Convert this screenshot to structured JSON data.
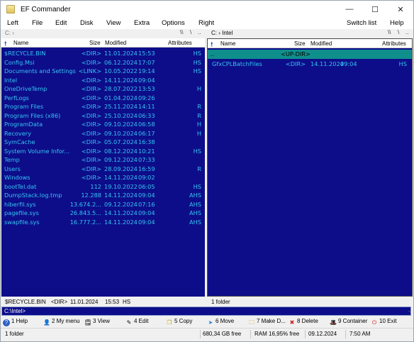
{
  "window": {
    "title": "EF Commander",
    "controls": {
      "minimize": "—",
      "maximize": "☐",
      "close": "✕"
    }
  },
  "menu": {
    "items": [
      "Left",
      "File",
      "Edit",
      "Disk",
      "View",
      "Extra",
      "Options",
      "Right"
    ],
    "switch_list": "Switch list",
    "help": "Help"
  },
  "left_panel": {
    "path": "C: ›",
    "path_controls": [
      "\\\\",
      "\\",
      ".."
    ],
    "headers": {
      "name": "Name",
      "size": "Size",
      "modified": "Modified",
      "attributes": "Attributes"
    },
    "rows": [
      {
        "name": "$RECYCLE.BIN",
        "size": "<DIR>",
        "date": "11.01.2024",
        "time": "15:53",
        "attr": "HS"
      },
      {
        "name": "Config.Msi",
        "size": "<DIR>",
        "date": "06.12.2024",
        "time": "17:07",
        "attr": "HS"
      },
      {
        "name": "Documents and Settings",
        "size": "<LINK>",
        "date": "10.05.2022",
        "time": "19:14",
        "attr": "HS"
      },
      {
        "name": "Intel",
        "size": "<DIR>",
        "date": "14.11.2024",
        "time": "09:04",
        "attr": ""
      },
      {
        "name": "OneDriveTemp",
        "size": "<DIR>",
        "date": "28.07.2022",
        "time": "13:53",
        "attr": "H"
      },
      {
        "name": "PerfLogs",
        "size": "<DIR>",
        "date": "01.04.2024",
        "time": "09:26",
        "attr": ""
      },
      {
        "name": "Program Files",
        "size": "<DIR>",
        "date": "25.11.2024",
        "time": "14:11",
        "attr": "R"
      },
      {
        "name": "Program Files (x86)",
        "size": "<DIR>",
        "date": "25.10.2024",
        "time": "06:33",
        "attr": "R"
      },
      {
        "name": "ProgramData",
        "size": "<DIR>",
        "date": "09.10.2024",
        "time": "06:58",
        "attr": "H"
      },
      {
        "name": "Recovery",
        "size": "<DIR>",
        "date": "09.10.2024",
        "time": "06:17",
        "attr": "H"
      },
      {
        "name": "SymCache",
        "size": "<DIR>",
        "date": "05.07.2024",
        "time": "16:38",
        "attr": ""
      },
      {
        "name": "System Volume Infor...",
        "size": "<DIR>",
        "date": "08.12.2024",
        "time": "10:21",
        "attr": "HS"
      },
      {
        "name": "Temp",
        "size": "<DIR>",
        "date": "09.12.2024",
        "time": "07:33",
        "attr": ""
      },
      {
        "name": "Users",
        "size": "<DIR>",
        "date": "28.09.2024",
        "time": "16:59",
        "attr": "R"
      },
      {
        "name": "Windows",
        "size": "<DIR>",
        "date": "14.11.2024",
        "time": "09:02",
        "attr": ""
      },
      {
        "name": "bootTel.dat",
        "size": "112",
        "date": "19.10.2022",
        "time": "06:05",
        "attr": "HS"
      },
      {
        "name": "DumpStack.log.tmp",
        "size": "12.288",
        "date": "14.11.2024",
        "time": "09:04",
        "attr": "AHS"
      },
      {
        "name": "hiberfil.sys",
        "size": "13.674.2...",
        "date": "09.12.2024",
        "time": "07:16",
        "attr": "AHS"
      },
      {
        "name": "pagefile.sys",
        "size": "26.843.5...",
        "date": "14.11.2024",
        "time": "09:04",
        "attr": "AHS"
      },
      {
        "name": "swapfile.sys",
        "size": "16.777.2...",
        "date": "14.11.2024",
        "time": "09:04",
        "attr": "AHS"
      }
    ],
    "info": {
      "name": "$RECYCLE.BIN",
      "size": "<DIR>",
      "date": "11.01.2024",
      "time": "15:53",
      "attr": "HS"
    }
  },
  "right_panel": {
    "path": "C: › Intel",
    "path_controls": [
      "\\\\",
      "\\",
      ".."
    ],
    "headers": {
      "name": "Name",
      "size": "Size",
      "modified": "Modified",
      "attributes": "Attributes"
    },
    "updir": {
      "name": "..",
      "label": "<UP-DIR>"
    },
    "rows": [
      {
        "name": "GfxCPLBatchFiles",
        "size": "<DIR>",
        "date": "14.11.2024",
        "time": "09:04",
        "attr": "HS"
      }
    ],
    "info": "1 folder"
  },
  "command_line": {
    "value": "C:\\Intel>"
  },
  "function_keys": [
    {
      "label": "1 Help",
      "icon": "help-icon"
    },
    {
      "label": "2 My menu",
      "icon": "user-icon"
    },
    {
      "label": "3 View",
      "icon": "view-icon"
    },
    {
      "label": "4 Edit",
      "icon": "edit-icon"
    },
    {
      "label": "5 Copy",
      "icon": "copy-icon"
    },
    {
      "label": "6 Move",
      "icon": "move-icon"
    },
    {
      "label": "7 Make D...",
      "icon": "make-dir-icon"
    },
    {
      "label": "8 Delete",
      "icon": "delete-icon"
    },
    {
      "label": "9 Container",
      "icon": "container-icon"
    },
    {
      "label": "10 Exit",
      "icon": "exit-icon"
    }
  ],
  "statusbar": {
    "selection": "1 folder",
    "free_space": "680,34 GB free",
    "ram": "RAM 16,95% free",
    "date": "09.12.2024",
    "time": "7:50 AM"
  },
  "colors": {
    "panel_bg": "#0d0d8a",
    "file_text": "#35c4f2",
    "selected_row": "#0f8f8c"
  }
}
